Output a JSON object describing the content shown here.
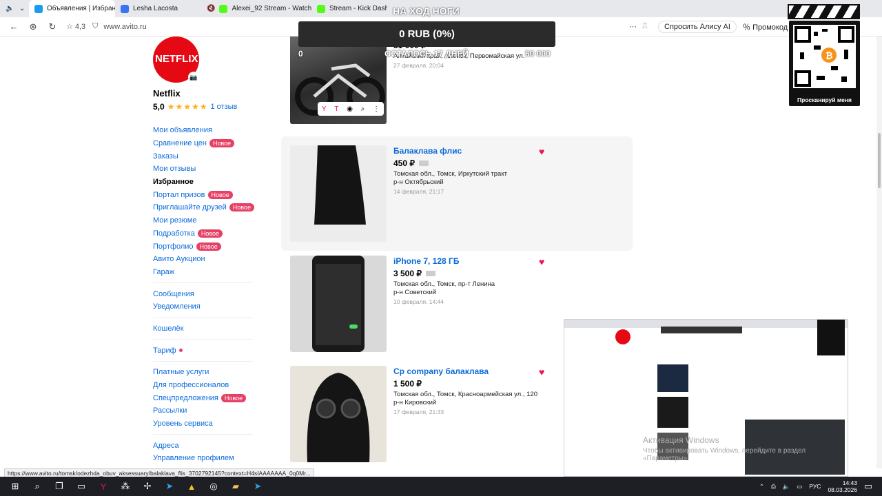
{
  "tabs": [
    {
      "title": "Объявления | Избранн",
      "active": true,
      "color": "#1a9bf0"
    },
    {
      "title": "Lesha Lacosta",
      "active": false,
      "color": "#3b73f5"
    },
    {
      "title": "Alexei_92 Stream - Watch",
      "active": false,
      "color": "#53fc18"
    },
    {
      "title": "Stream - Kick Dashbo",
      "active": false,
      "color": "#53fc18"
    }
  ],
  "address": {
    "rating": "4,3",
    "url": "www.avito.ru",
    "alisa": "Спросить Алису AI",
    "promo": "Промокод"
  },
  "profile": {
    "logo_text": "NETFLIX",
    "name": "Netflix",
    "score": "5,0",
    "stars": "★★★★★",
    "reviews": "1 отзыв"
  },
  "menu": [
    {
      "label": "Мои объявления"
    },
    {
      "label": "Сравнение цен",
      "badge": "Новое"
    },
    {
      "label": "Заказы"
    },
    {
      "label": "Мои отзывы"
    },
    {
      "label": "Избранное",
      "current": true
    },
    {
      "label": "Портал призов",
      "badge": "Новое"
    },
    {
      "label": "Приглашайте друзей",
      "badge": "Новое"
    },
    {
      "label": "Мои резюме"
    },
    {
      "label": "Подработка",
      "badge": "Новое"
    },
    {
      "label": "Портфолио",
      "badge": "Новое"
    },
    {
      "label": "Авито Аукцион"
    },
    {
      "label": "Гараж"
    }
  ],
  "menu2": [
    {
      "label": "Сообщения"
    },
    {
      "label": "Уведомления"
    }
  ],
  "menu3": [
    {
      "label": "Кошелёк"
    }
  ],
  "menu4": [
    {
      "label": "Тариф"
    }
  ],
  "menu5": [
    {
      "label": "Платные услуги"
    },
    {
      "label": "Для профессионалов"
    },
    {
      "label": "Спецпредложения",
      "badge": "Новое"
    },
    {
      "label": "Рассылки"
    },
    {
      "label": "Уровень сервиса"
    }
  ],
  "menu6": [
    {
      "label": "Адреса"
    },
    {
      "label": "Управление профилем"
    }
  ],
  "listings": [
    {
      "title": "",
      "price": "51 000 ₽",
      "location": "Алтайский край, Алейск, Первомайская ул.",
      "district": "",
      "date": "27 февраля, 20:04"
    },
    {
      "title": "Балаклава флис",
      "price": "450 ₽",
      "location": "Томская обл., Томск, Иркутский тракт",
      "district": "р-н Октябрьский",
      "date": "14 февраля, 21:17"
    },
    {
      "title": "iPhone 7, 128 ГБ",
      "price": "3 500 ₽",
      "location": "Томская обл., Томск, пр-т Ленина",
      "district": "р-н Советский",
      "date": "10 февраля, 14:44"
    },
    {
      "title": "Cp company балаклава",
      "price": "1 500 ₽",
      "location": "Томская обл., Томск, Красноармейская ул., 120",
      "district": "р-н Кировский",
      "date": "17 февраля, 21:33"
    }
  ],
  "overlay": {
    "title": "НА ХОД НОГИ",
    "amount": "0 RUB (0%)",
    "left_value": "0",
    "remaining": "ОСТАЛОСЬ 17 ДНЕЙ",
    "goal": "50 000"
  },
  "qr_caption": "Просканируй меня",
  "pip_watermark": "Активация Windows",
  "pip_watermark2": "Чтобы активировать Windows, перейдите в раздел «Параметры».",
  "status_url": "https://www.avito.ru/tomsk/odezhda_obuv_aksessuary/balaklava_flis_3702792145?context=H4sIAAAAAAA_0q0Mr...",
  "taskbar": {
    "lang": "РУС",
    "time": "14:43",
    "date": "08.03.2026"
  }
}
